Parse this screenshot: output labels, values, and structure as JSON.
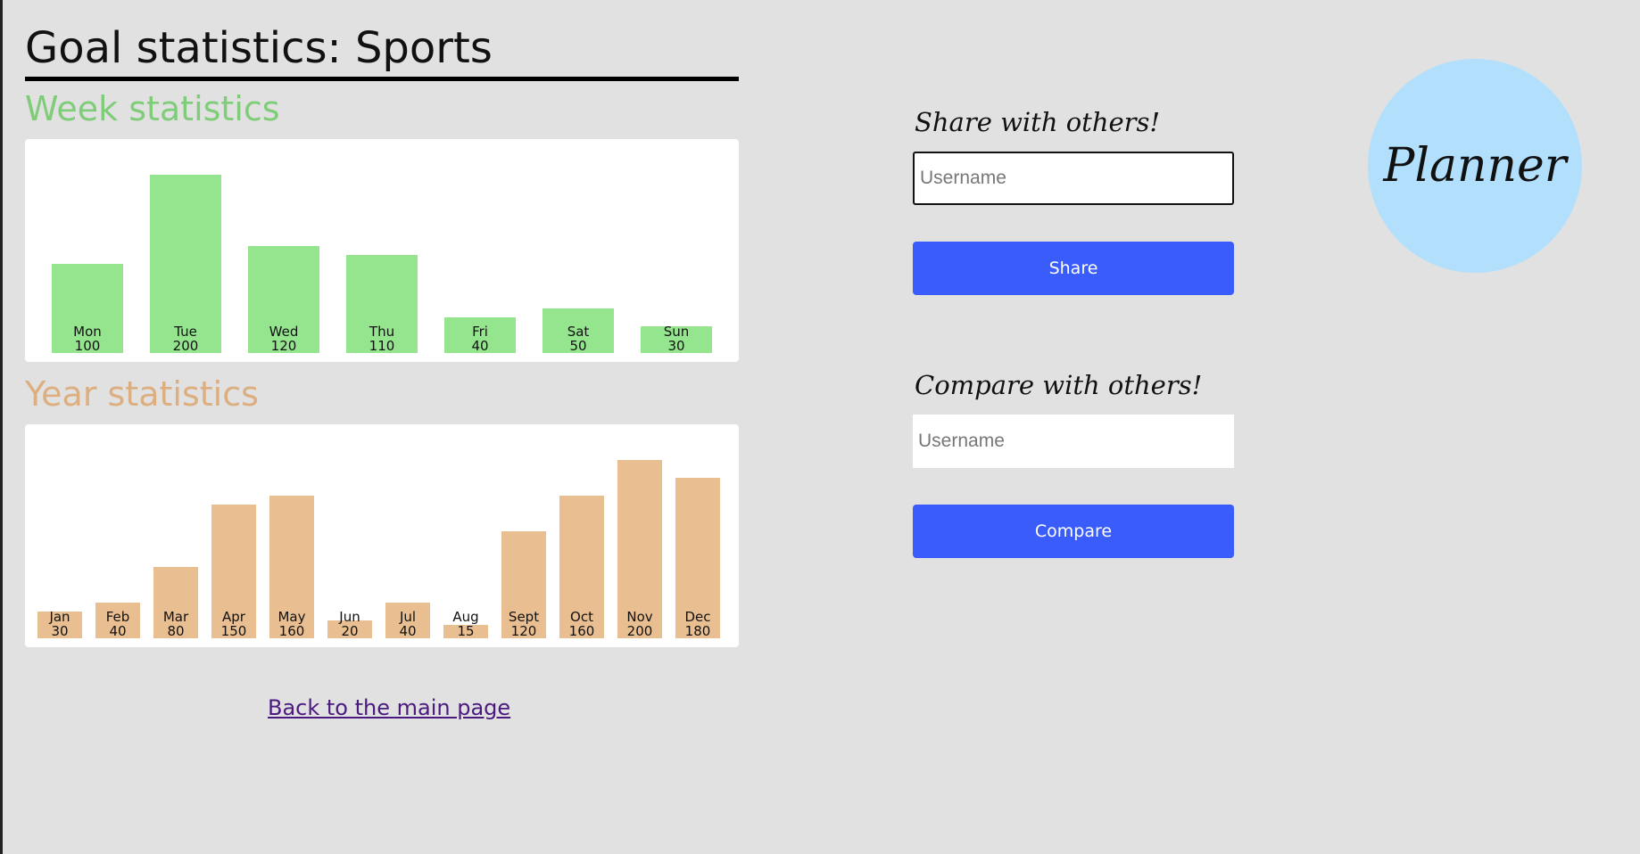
{
  "page": {
    "title": "Goal statistics: Sports",
    "back_link": "Back to the main page"
  },
  "week": {
    "heading": "Week statistics",
    "color": "#95e58f",
    "heading_color": "#7fcc79"
  },
  "year": {
    "heading": "Year statistics",
    "color": "#e9bf91",
    "heading_color": "#dcae80"
  },
  "share": {
    "heading": "Share with others!",
    "placeholder": "Username",
    "button_label": "Share"
  },
  "compare": {
    "heading": "Compare with others!",
    "placeholder": "Username",
    "button_label": "Compare"
  },
  "logo": {
    "text": "Planner",
    "color": "#b2e0fc"
  },
  "button_color": "#3a5cfb",
  "chart_data": [
    {
      "type": "bar",
      "title": "Week statistics",
      "categories": [
        "Mon",
        "Tue",
        "Wed",
        "Thu",
        "Fri",
        "Sat",
        "Sun"
      ],
      "values": [
        100,
        200,
        120,
        110,
        40,
        50,
        30
      ],
      "ylim": [
        0,
        200
      ],
      "grid": false
    },
    {
      "type": "bar",
      "title": "Year statistics",
      "categories": [
        "Jan",
        "Feb",
        "Mar",
        "Apr",
        "May",
        "Jun",
        "Jul",
        "Aug",
        "Sept",
        "Oct",
        "Nov",
        "Dec"
      ],
      "values": [
        30,
        40,
        80,
        150,
        160,
        20,
        40,
        15,
        120,
        160,
        200,
        180
      ],
      "ylim": [
        0,
        200
      ],
      "grid": false
    }
  ]
}
